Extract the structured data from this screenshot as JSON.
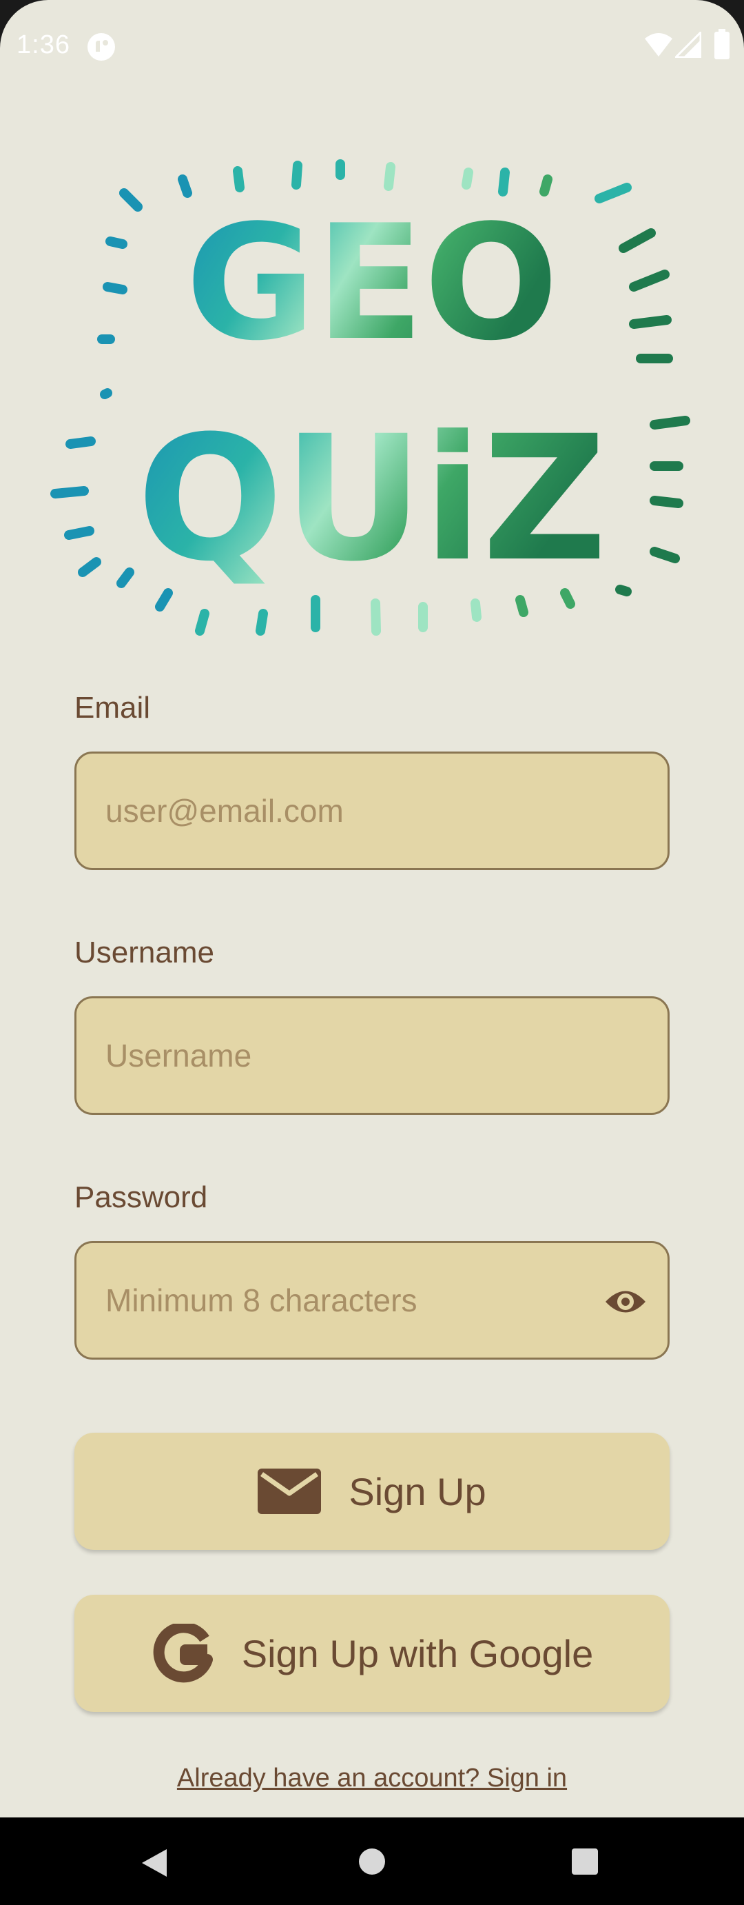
{
  "status_bar": {
    "time": "1:36",
    "icons": [
      "app-notification-icon",
      "wifi-icon",
      "signal-icon",
      "battery-icon"
    ]
  },
  "logo": {
    "line1": "GEO",
    "line2": "QUiZ",
    "colors": [
      "#1a93b3",
      "#2bb3a8",
      "#9ee4c2",
      "#3ea766",
      "#1f7a4d"
    ]
  },
  "form": {
    "email": {
      "label": "Email",
      "placeholder": "user@email.com",
      "value": ""
    },
    "username": {
      "label": "Username",
      "placeholder": "Username",
      "value": ""
    },
    "password": {
      "label": "Password",
      "placeholder": "Minimum 8 characters",
      "value": "",
      "toggle_icon": "eye-icon"
    }
  },
  "buttons": {
    "sign_up": {
      "label": "Sign Up",
      "icon": "envelope-icon"
    },
    "sign_up_google": {
      "label": "Sign Up with Google",
      "icon": "google-g-icon"
    }
  },
  "signin_link": "Already have an account? Sign in",
  "navigation": [
    "back-icon",
    "home-icon",
    "recents-icon"
  ],
  "theme": {
    "background": "#e8e7dc",
    "field_fill": "#e3d6a7",
    "field_border": "#8a7652",
    "text": "#6a4a33",
    "placeholder": "#a88f66"
  }
}
